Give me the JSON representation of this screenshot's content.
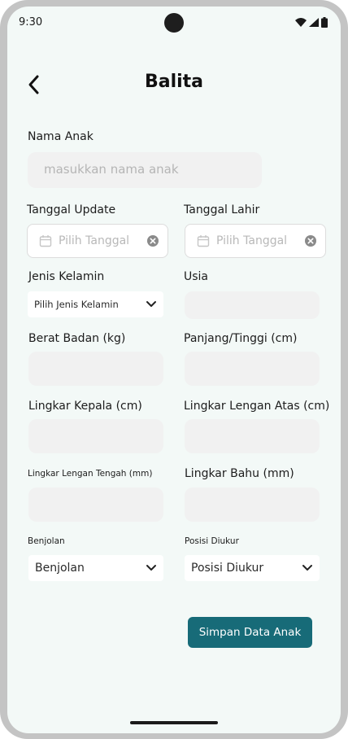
{
  "status_bar": {
    "time": "9:30"
  },
  "header": {
    "title": "Balita"
  },
  "form": {
    "nama_anak": {
      "label": "Nama Anak",
      "placeholder": "masukkan nama anak"
    },
    "tanggal_update": {
      "label": "Tanggal Update",
      "placeholder": "Pilih Tanggal"
    },
    "tanggal_lahir": {
      "label": "Tanggal Lahir",
      "placeholder": "Pilih Tanggal"
    },
    "jenis_kelamin": {
      "label": "Jenis Kelamin",
      "value": "Pilih Jenis Kelamin"
    },
    "usia": {
      "label": "Usia",
      "value": ""
    },
    "berat_badan": {
      "label": "Berat Badan (kg)",
      "value": ""
    },
    "panjang_tinggi": {
      "label": "Panjang/Tinggi (cm)",
      "value": ""
    },
    "lingkar_kepala": {
      "label": "Lingkar Kepala (cm)",
      "value": ""
    },
    "lingkar_lengan_atas": {
      "label": "Lingkar Lengan Atas (cm)",
      "value": ""
    },
    "lingkar_lengan_tengah": {
      "label": "Lingkar Lengan Tengah (mm)",
      "value": ""
    },
    "lingkar_bahu": {
      "label": "Lingkar Bahu (mm)",
      "value": ""
    },
    "benjolan": {
      "label": "Benjolan",
      "value": "Benjolan"
    },
    "posisi_diukur": {
      "label": "Posisi Diukur",
      "value": "Posisi Diukur"
    }
  },
  "actions": {
    "save_label": "Simpan Data Anak"
  },
  "colors": {
    "accent": "#176b78",
    "background": "#f3f9f7",
    "field": "#f1f1f1"
  },
  "icons": [
    "back-arrow-icon",
    "calendar-icon",
    "clear-icon",
    "chevron-down-icon",
    "wifi-icon",
    "signal-icon",
    "battery-icon"
  ]
}
